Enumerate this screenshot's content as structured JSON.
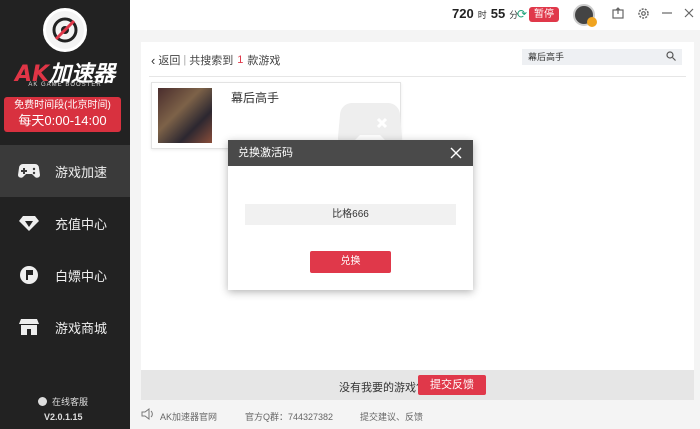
{
  "sidebar": {
    "logo": {
      "brand_ak": "AK",
      "brand_rest": "加速器",
      "subtitle": "AK GAME BOOSTER"
    },
    "free_time": {
      "line1": "免费时间段(北京时间)",
      "line2": "每天0:00-14:00"
    },
    "items": [
      {
        "label": "游戏加速",
        "icon": "gamepad-icon",
        "active": true
      },
      {
        "label": "充值中心",
        "icon": "diamond-icon",
        "active": false
      },
      {
        "label": "白嫖中心",
        "icon": "flag-icon",
        "active": false
      },
      {
        "label": "游戏商城",
        "icon": "store-icon",
        "active": false
      }
    ],
    "service_label": "在线客服",
    "version": "V2.0.1.15"
  },
  "topbar": {
    "hours_value": "720",
    "hours_unit": "时",
    "minutes_value": "55",
    "minutes_unit": "分",
    "pause_label": "暂停"
  },
  "main": {
    "back_label": "返回",
    "result_prefix": "共搜索到",
    "result_count": "1",
    "result_suffix": "款游戏",
    "search_value": "幕后高手",
    "game": {
      "title": "幕后高手"
    }
  },
  "feedback": {
    "text": "没有我要的游戏?",
    "button": "提交反馈"
  },
  "footer": {
    "site": "AK加速器官网",
    "qq_group": "官方Q群：744327382",
    "suggestion": "提交建议、反馈"
  },
  "modal": {
    "title": "兑换激活码",
    "code_value": "比格666",
    "confirm_label": "兑换"
  },
  "colors": {
    "accent": "#e0384a",
    "sidebar_bg": "#222222",
    "modal_header": "#4a4a4a"
  }
}
